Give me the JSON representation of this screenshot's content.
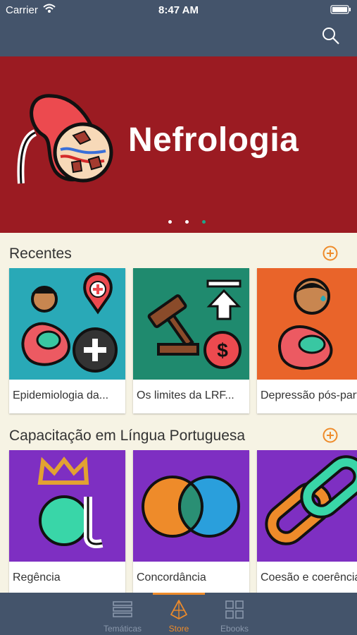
{
  "status_bar": {
    "carrier": "Carrier",
    "time": "8:47 AM"
  },
  "hero": {
    "title": "Nefrologia",
    "page_count": 3,
    "active_page": 3
  },
  "sections": [
    {
      "title": "Recentes",
      "cards": [
        {
          "label": "Epidemiologia da...",
          "color": "#29a9b7"
        },
        {
          "label": "Os limites da LRF...",
          "color": "#1f8a6e"
        },
        {
          "label": "Depressão pós-parto",
          "color": "#e9642a"
        }
      ]
    },
    {
      "title": "Capacitação em Língua Portuguesa",
      "cards": [
        {
          "label": "Regência",
          "color": "#7e2fc2"
        },
        {
          "label": "Concordância",
          "color": "#7e2fc2"
        },
        {
          "label": "Coesão e coerência",
          "color": "#7e2fc2"
        }
      ]
    }
  ],
  "tabs": [
    {
      "label": "Temáticas",
      "icon": "list-icon",
      "active": false
    },
    {
      "label": "Store",
      "icon": "store-icon",
      "active": true
    },
    {
      "label": "Ebooks",
      "icon": "grid-icon",
      "active": false
    }
  ],
  "colors": {
    "bar": "#44546b",
    "hero": "#9b1b22",
    "accent": "#ee8b2a",
    "background": "#f6f3e4"
  }
}
